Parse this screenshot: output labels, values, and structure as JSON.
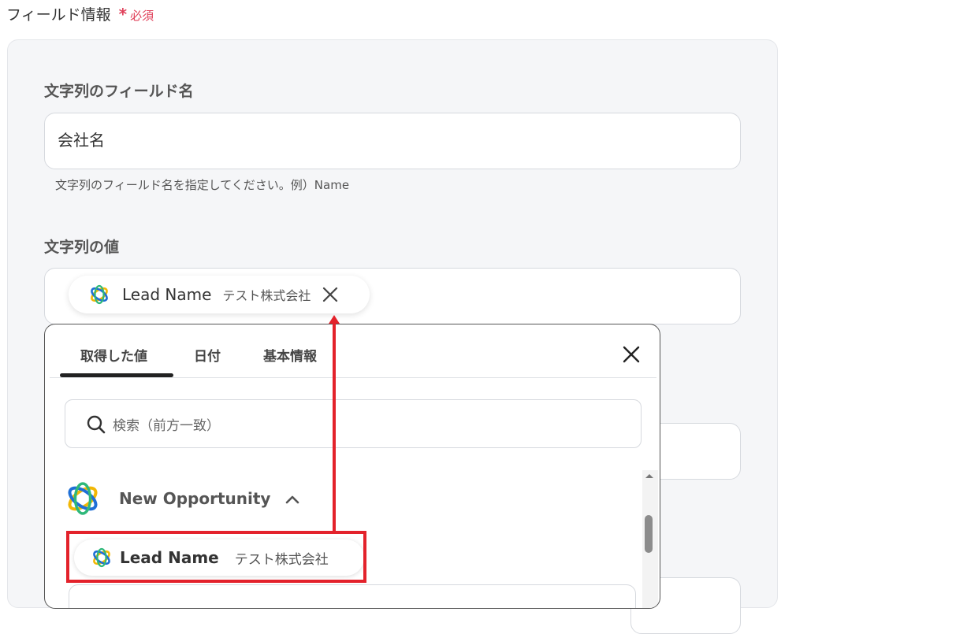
{
  "section": {
    "title": "フィールド情報",
    "required_label": "必須",
    "required_mark": "*"
  },
  "field_name": {
    "label": "文字列のフィールド名",
    "value": "会社名",
    "hint": "文字列のフィールド名を指定してください。例）Name"
  },
  "field_value": {
    "label": "文字列の値",
    "chip": {
      "name": "Lead Name",
      "sample": "テスト株式会社",
      "icon": "app-logo-icon"
    }
  },
  "dropdown": {
    "tabs": [
      {
        "label": "取得した値",
        "active": true
      },
      {
        "label": "日付",
        "active": false
      },
      {
        "label": "基本情報",
        "active": false
      }
    ],
    "search_placeholder": "検索（前方一致）",
    "group": {
      "title": "New Opportunity",
      "expanded": true
    },
    "items": [
      {
        "name": "Lead Name",
        "sample": "テスト株式会社"
      }
    ]
  },
  "colors": {
    "required": "#e0405a",
    "highlight": "#e3222b",
    "logo_yellow": "#f2b705",
    "logo_blue": "#1f6fd6",
    "logo_green": "#2eb87a"
  }
}
